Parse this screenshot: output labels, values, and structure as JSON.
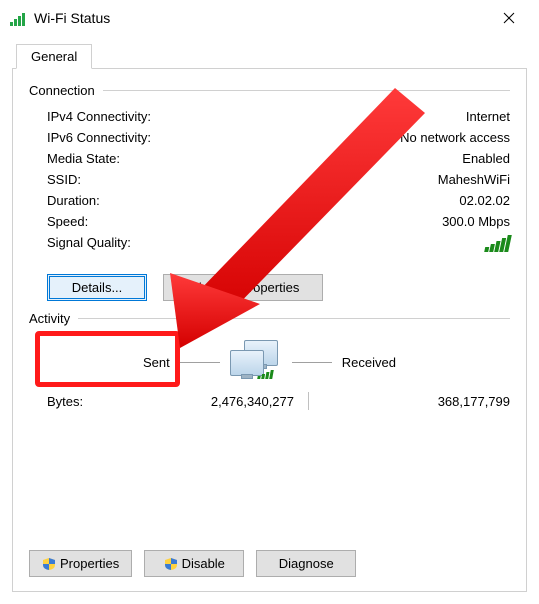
{
  "window": {
    "title": "Wi-Fi Status"
  },
  "tabs": {
    "general": "General"
  },
  "groups": {
    "connection": "Connection",
    "activity": "Activity"
  },
  "connection": {
    "ipv4_label": "IPv4 Connectivity:",
    "ipv4_value": "Internet",
    "ipv6_label": "IPv6 Connectivity:",
    "ipv6_value": "No network access",
    "media_label": "Media State:",
    "media_value": "Enabled",
    "ssid_label": "SSID:",
    "ssid_value": "MaheshWiFi",
    "duration_label": "Duration:",
    "duration_value": "02.02.02",
    "speed_label": "Speed:",
    "speed_value": "300.0 Mbps",
    "signal_label": "Signal Quality:"
  },
  "buttons": {
    "details": "Details...",
    "wireless_props": "Wireless Properties",
    "properties": "Properties",
    "disable": "Disable",
    "diagnose": "Diagnose"
  },
  "activity": {
    "sent_label": "Sent",
    "received_label": "Received",
    "bytes_label": "Bytes:",
    "bytes_sent": "2,476,340,277",
    "bytes_received": "368,177,799"
  }
}
